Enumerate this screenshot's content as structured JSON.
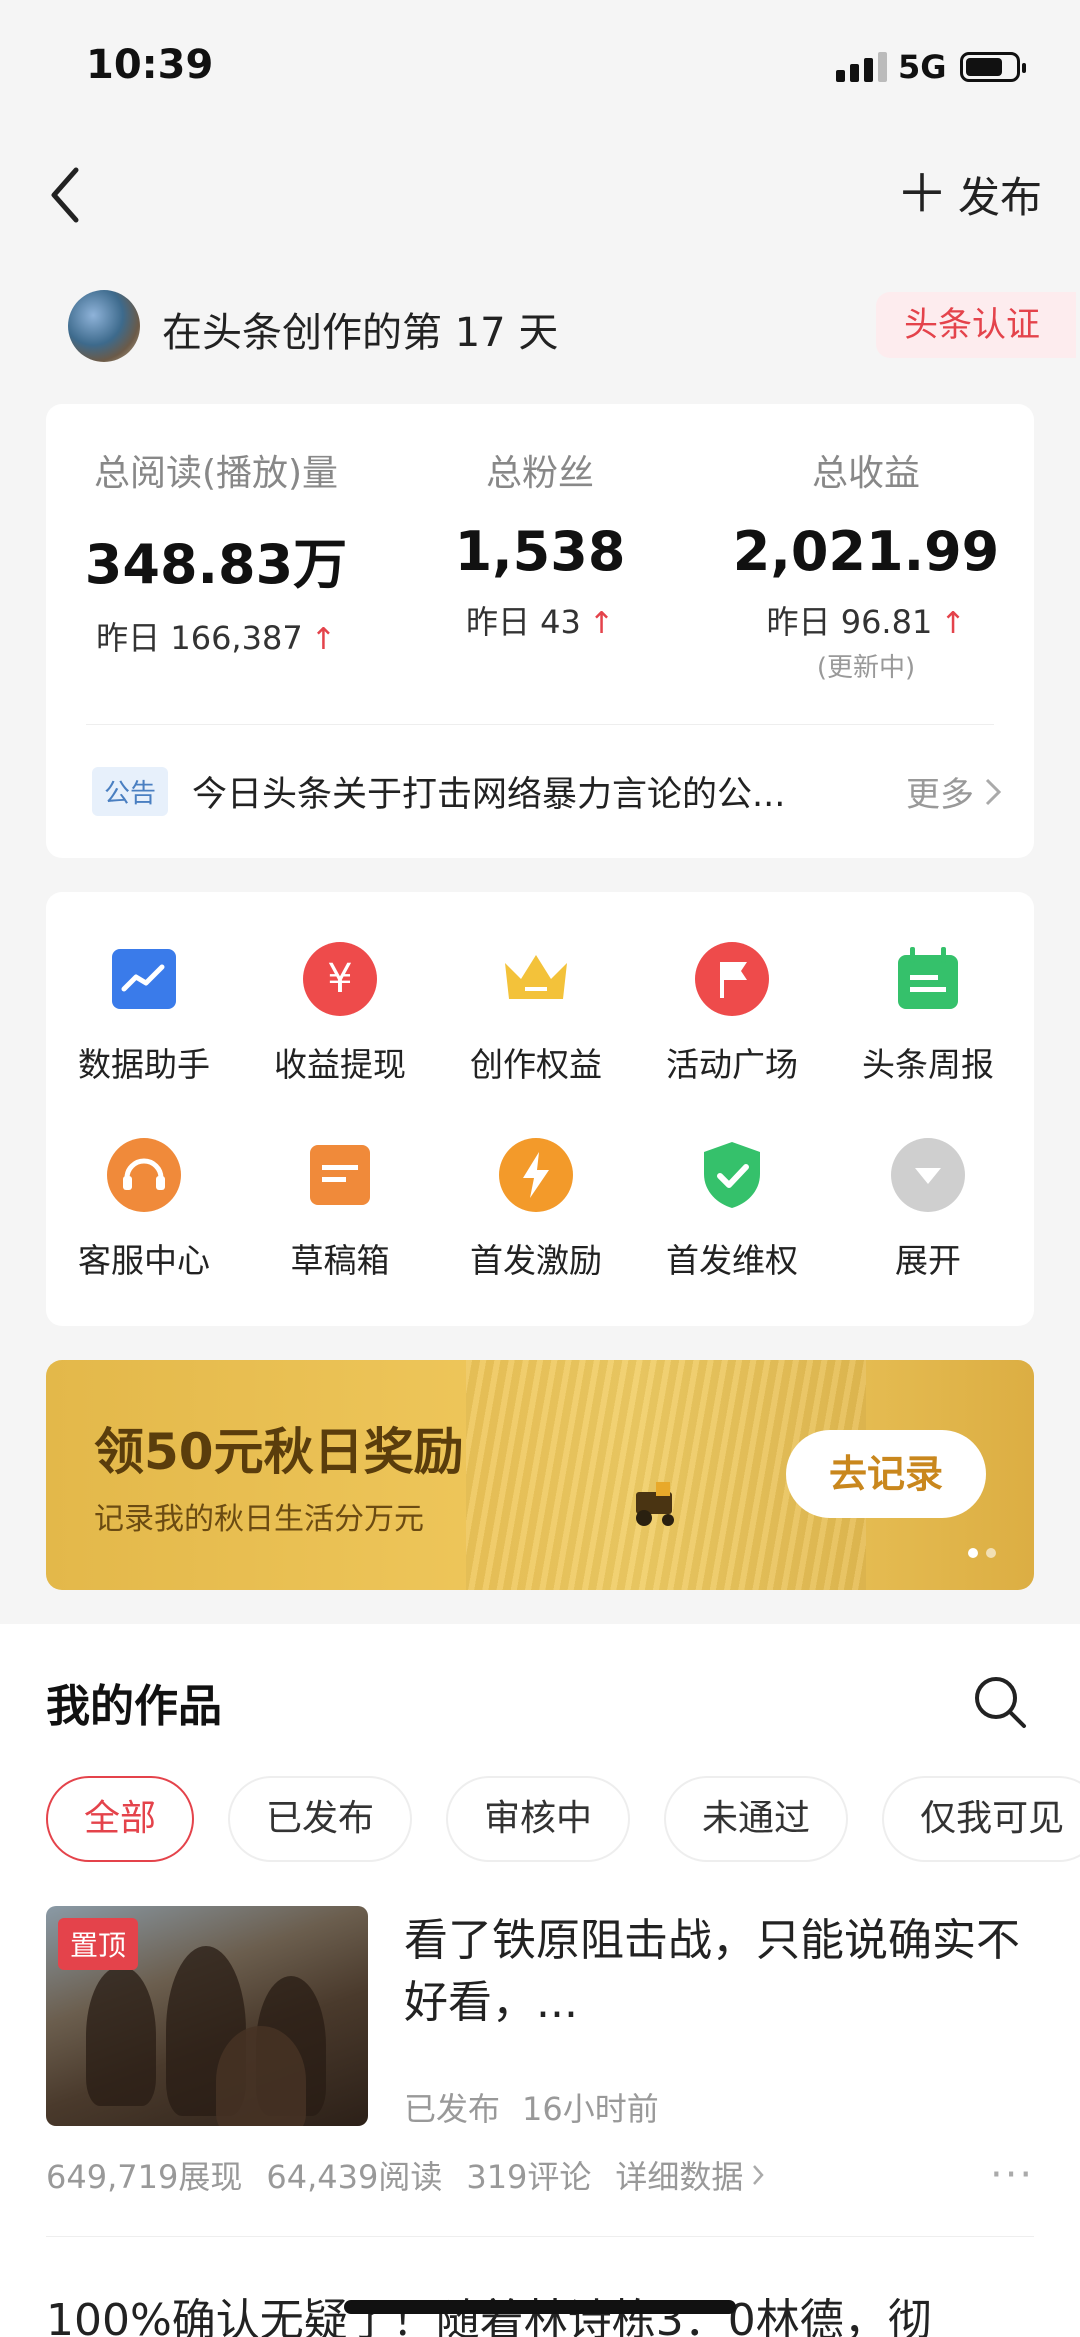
{
  "status_bar": {
    "time": "10:39",
    "network": "5G"
  },
  "header": {
    "publish_label": "发布"
  },
  "profile": {
    "days_text": "在头条创作的第 17 天",
    "certify_label": "头条认证"
  },
  "stats": [
    {
      "label": "总阅读(播放)量",
      "value": "348.83万",
      "yesterday": "昨日 166,387",
      "arrow": "↑"
    },
    {
      "label": "总粉丝",
      "value": "1,538",
      "yesterday": "昨日 43",
      "arrow": "↑"
    },
    {
      "label": "总收益",
      "value": "2,021.99",
      "yesterday": "昨日 96.81",
      "arrow": "↑",
      "note": "(更新中)"
    }
  ],
  "notice": {
    "tag": "公告",
    "text": "今日头条关于打击网络暴力言论的公...",
    "more": "更多"
  },
  "tools": [
    {
      "label": "数据助手",
      "icon": "chart-icon"
    },
    {
      "label": "收益提现",
      "icon": "yuan-icon"
    },
    {
      "label": "创作权益",
      "icon": "crown-icon"
    },
    {
      "label": "活动广场",
      "icon": "flag-icon"
    },
    {
      "label": "头条周报",
      "icon": "calendar-icon"
    },
    {
      "label": "客服中心",
      "icon": "headset-icon"
    },
    {
      "label": "草稿箱",
      "icon": "draft-icon"
    },
    {
      "label": "首发激励",
      "icon": "lightning-icon"
    },
    {
      "label": "首发维权",
      "icon": "shield-icon"
    },
    {
      "label": "展开",
      "icon": "expand-icon"
    }
  ],
  "banner": {
    "title": "领50元秋日奖励",
    "subtitle": "记录我的秋日生活分万元",
    "button": "去记录"
  },
  "works": {
    "title": "我的作品",
    "tabs": [
      "全部",
      "已发布",
      "审核中",
      "未通过",
      "仅我可见"
    ],
    "active_tab": 0,
    "article": {
      "pin": "置顶",
      "title": "看了铁原阻击战，只能说确实不好看，...",
      "status": "已发布",
      "time": "16小时前",
      "impressions": "649,719展现",
      "reads": "64,439阅读",
      "comments": "319评论",
      "details": "详细数据"
    },
    "next_title": "100%确认无疑了！随着林诗栋3：0林德，彻"
  },
  "colors": {
    "accent": "#e4434b",
    "blue": "#3a7bea",
    "orange": "#f08a3a",
    "green": "#35c16b",
    "gold": "#f3c23a"
  }
}
